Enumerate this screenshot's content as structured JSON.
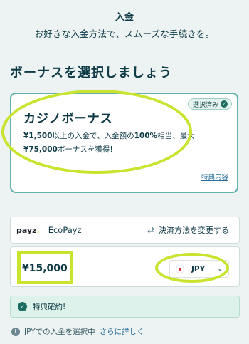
{
  "header": {
    "title": "入金",
    "subtitle": "お好きな入金方法で、スムーズな手続きを。"
  },
  "bonus_section": {
    "title": "ボーナスを選択しましょう",
    "card": {
      "badge": "選択済み",
      "title": "カジノボーナス",
      "desc_part1": "¥1,500",
      "desc_part2": "以上の入金で、入金額の",
      "desc_part3": "100%",
      "desc_part4": "相当、最大",
      "desc_part5": "¥75,000",
      "desc_part6": "ボーナスを獲得!",
      "details_link": "特典内容"
    }
  },
  "payment": {
    "logo_text": "payz",
    "method": "EcoPayz",
    "change_label": "決済方法を変更する",
    "icon": "swap-icon"
  },
  "amount": {
    "value": "¥15,000",
    "currency": "JPY",
    "flag_icon": "japan-flag-icon"
  },
  "confirmation": {
    "text": "特典確約!"
  },
  "info": {
    "text": "JPYでの入金を選択中",
    "link": "さらに詳しく"
  },
  "colors": {
    "background": "#edf2f2",
    "text": "#0e3a46",
    "card_border": "#62b3ad",
    "highlight": "#c9e32f",
    "success_bg": "#ddf2ea",
    "link": "#2a6f9a"
  }
}
